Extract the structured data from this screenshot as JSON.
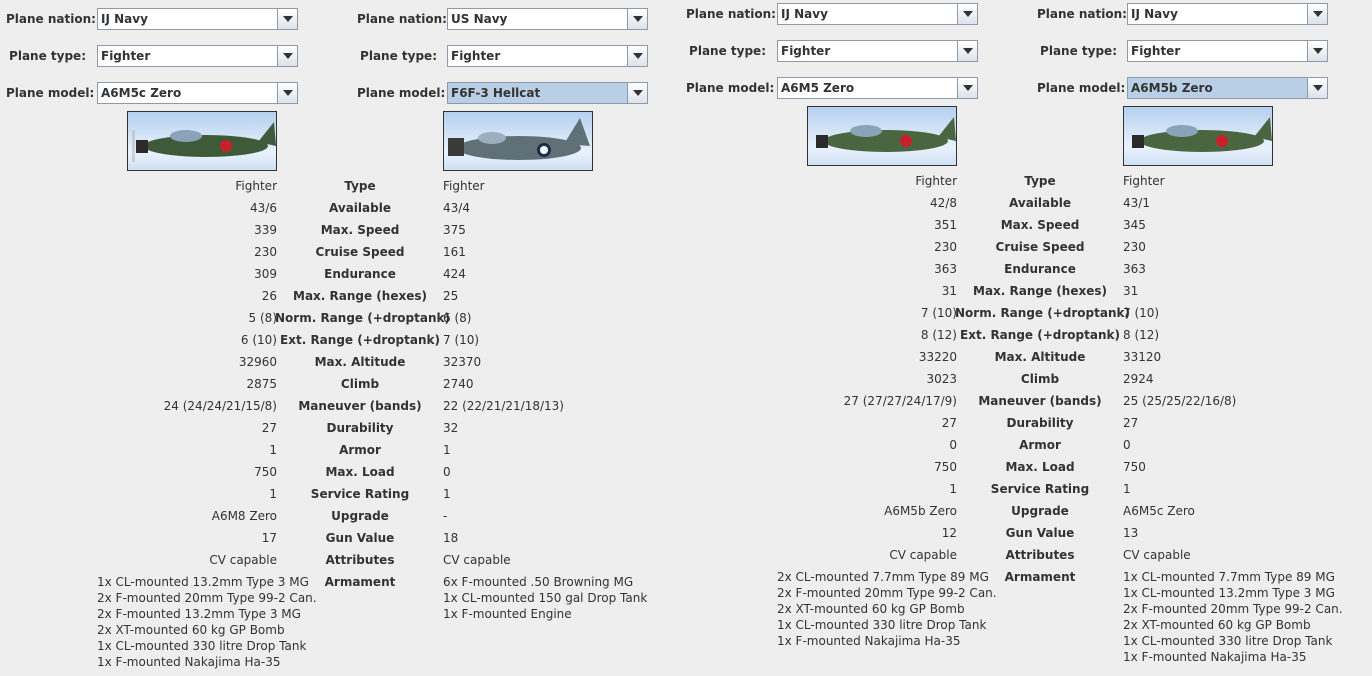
{
  "labels": {
    "plane_nation": "Plane nation:",
    "plane_type": "Plane type:",
    "plane_model": "Plane model:"
  },
  "stat_labels": [
    "Type",
    "Available",
    "Max. Speed",
    "Cruise Speed",
    "Endurance",
    "Max. Range (hexes)",
    "Norm. Range (+droptank)",
    "Ext. Range (+droptank)",
    "Max. Altitude",
    "Climb",
    "Maneuver (bands)",
    "Durability",
    "Armor",
    "Max. Load",
    "Service Rating",
    "Upgrade",
    "Gun Value",
    "Attributes",
    "Armament"
  ],
  "panels": [
    {
      "left": {
        "nation": "IJ Navy",
        "type": "Fighter",
        "model": "A6M5c Zero",
        "stats": [
          "Fighter",
          "43/6",
          "339",
          "230",
          "309",
          "26",
          "5 (8)",
          "6 (10)",
          "32960",
          "2875",
          "24 (24/24/21/15/8)",
          "27",
          "1",
          "750",
          "1",
          "A6M8 Zero",
          "17",
          "CV capable"
        ],
        "armament": [
          "1x CL-mounted 13.2mm Type 3 MG",
          "2x F-mounted 20mm Type 99-2 Can.",
          "2x F-mounted 13.2mm Type 3 MG",
          "2x XT-mounted 60 kg GP Bomb",
          "1x CL-mounted 330 litre Drop Tank",
          "1x F-mounted Nakajima Ha-35"
        ]
      },
      "right": {
        "nation": "US Navy",
        "type": "Fighter",
        "model": "F6F-3 Hellcat",
        "stats": [
          "Fighter",
          "43/4",
          "375",
          "161",
          "424",
          "25",
          "6 (8)",
          "7 (10)",
          "32370",
          "2740",
          "22 (22/21/21/18/13)",
          "32",
          "1",
          "0",
          "1",
          "-",
          "18",
          "CV capable"
        ],
        "armament": [
          "6x F-mounted .50 Browning MG",
          "1x CL-mounted 150 gal Drop Tank",
          "1x F-mounted Engine"
        ]
      }
    },
    {
      "left": {
        "nation": "IJ Navy",
        "type": "Fighter",
        "model": "A6M5 Zero",
        "stats": [
          "Fighter",
          "42/8",
          "351",
          "230",
          "363",
          "31",
          "7 (10)",
          "8 (12)",
          "33220",
          "3023",
          "27 (27/27/24/17/9)",
          "27",
          "0",
          "750",
          "1",
          "A6M5b Zero",
          "12",
          "CV capable"
        ],
        "armament": [
          "2x CL-mounted 7.7mm Type 89 MG",
          "2x F-mounted 20mm Type 99-2 Can.",
          "2x XT-mounted 60 kg GP Bomb",
          "1x CL-mounted 330 litre Drop Tank",
          "1x F-mounted Nakajima Ha-35"
        ]
      },
      "right": {
        "nation": "IJ Navy",
        "type": "Fighter",
        "model": "A6M5b Zero",
        "stats": [
          "Fighter",
          "43/1",
          "345",
          "230",
          "363",
          "31",
          "7 (10)",
          "8 (12)",
          "33120",
          "2924",
          "25 (25/25/22/16/8)",
          "27",
          "0",
          "750",
          "1",
          "A6M5c Zero",
          "13",
          "CV capable"
        ],
        "armament": [
          "1x CL-mounted 7.7mm Type 89 MG",
          "1x CL-mounted 13.2mm Type 3 MG",
          "2x F-mounted 20mm Type 99-2 Can.",
          "2x XT-mounted 60 kg GP Bomb",
          "1x CL-mounted 330 litre Drop Tank",
          "1x F-mounted Nakajima Ha-35"
        ]
      }
    }
  ],
  "icons": {
    "dropdown": "chevron-down-icon",
    "plane": "plane-image"
  }
}
